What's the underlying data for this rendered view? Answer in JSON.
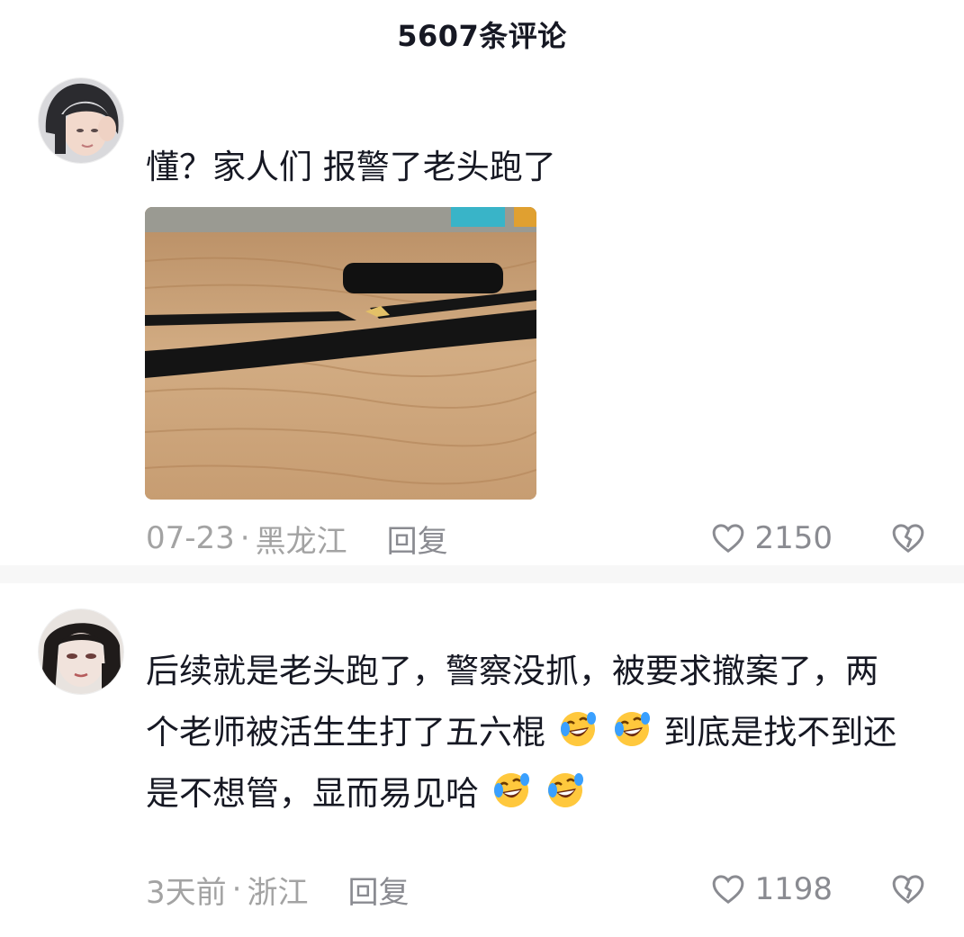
{
  "header": {
    "title": "5607条评论"
  },
  "icons": {
    "like": "heart-outline-icon",
    "dislike": "broken-heart-icon",
    "emoji": "rofl-crying-laughing-emoji"
  },
  "colors": {
    "meta_text": "#a3a3a3",
    "action_text": "#8a8b91",
    "body_text": "#161823",
    "divider": "#f7f7f7"
  },
  "comments": [
    {
      "text": "懂？家人们 报警了老头跑了",
      "has_image": true,
      "date": "07-23",
      "location": "黑龙江",
      "separator": "·",
      "reply_label": "回复",
      "like_count": "2150"
    },
    {
      "text_part1": "后续就是老头跑了，警察没抓，被要求撤案了，两个老师被活生生打了五六棍",
      "text_part2": "到底是找不到还是不想管，显而易见哈",
      "has_image": false,
      "date": "3天前",
      "location": "浙江",
      "separator": "·",
      "reply_label": "回复",
      "like_count": "1198"
    }
  ]
}
